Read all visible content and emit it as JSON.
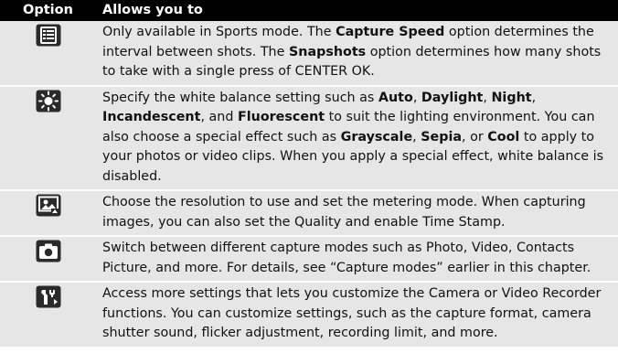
{
  "header": {
    "col1": "Option",
    "col2": "Allows you to"
  },
  "rows": [
    {
      "icon": "options-list-icon",
      "parts": [
        {
          "t": "Only available in Sports mode. The "
        },
        {
          "t": "Capture Speed",
          "b": true
        },
        {
          "t": " option determines the interval between shots. The "
        },
        {
          "t": "Snapshots",
          "b": true
        },
        {
          "t": " option determines how many shots to take with a single press of CENTER OK."
        }
      ]
    },
    {
      "icon": "white-balance-sun-icon",
      "parts": [
        {
          "t": "Specify the white balance setting such as "
        },
        {
          "t": "Auto",
          "b": true
        },
        {
          "t": ", "
        },
        {
          "t": "Daylight",
          "b": true
        },
        {
          "t": ", "
        },
        {
          "t": "Night",
          "b": true
        },
        {
          "t": ", "
        },
        {
          "t": "Incandescent",
          "b": true
        },
        {
          "t": ", and "
        },
        {
          "t": "Fluorescent",
          "b": true
        },
        {
          "t": " to suit the lighting environment. You can also choose a special effect such as "
        },
        {
          "t": "Grayscale",
          "b": true
        },
        {
          "t": ", "
        },
        {
          "t": "Sepia",
          "b": true
        },
        {
          "t": ", or "
        },
        {
          "t": "Cool",
          "b": true
        },
        {
          "t": " to apply to your photos or video clips. When you apply a special effect, white balance is disabled."
        }
      ]
    },
    {
      "icon": "resolution-settings-icon",
      "parts": [
        {
          "t": "Choose the resolution to use and set the metering mode. When capturing images, you can also set the Quality and enable Time Stamp."
        }
      ]
    },
    {
      "icon": "camera-mode-icon",
      "parts": [
        {
          "t": "Switch between different capture modes such as Photo, Video, Contacts Picture, and more. For details, see “Capture modes” earlier in this chapter."
        }
      ]
    },
    {
      "icon": "tools-settings-icon",
      "parts": [
        {
          "t": "Access more settings that lets you customize the Camera or Video Recorder functions. You can customize settings, such as the capture format, camera shutter sound, flicker adjustment, recording limit, and more."
        }
      ]
    }
  ]
}
